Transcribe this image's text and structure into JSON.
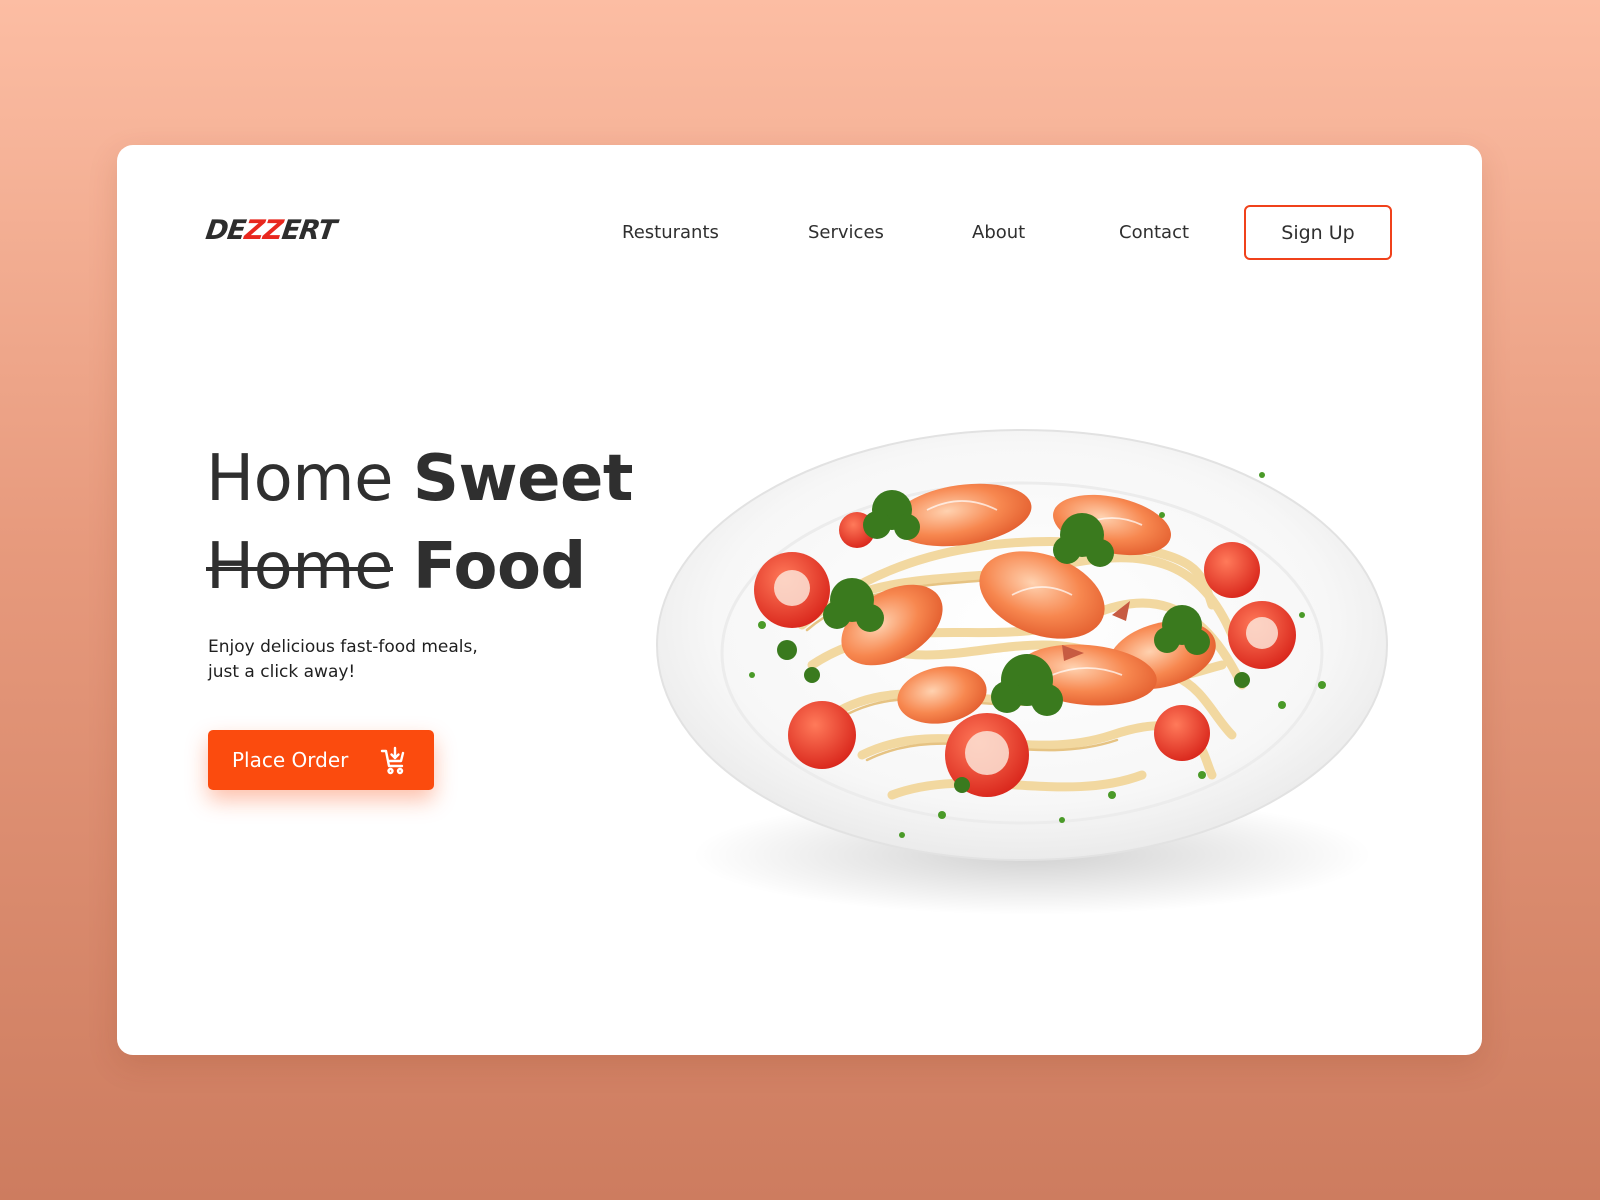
{
  "brand": {
    "logo_part1": "DE",
    "logo_part2": "ZZ",
    "logo_part3": "ERT"
  },
  "nav": {
    "items": [
      {
        "label": "Resturants"
      },
      {
        "label": "Services"
      },
      {
        "label": "About"
      },
      {
        "label": "Contact"
      }
    ],
    "signup_label": "Sign Up"
  },
  "hero": {
    "line1_light": "Home",
    "line1_bold": "Sweet",
    "line2_strike": "Home",
    "line2_bold": "Food",
    "tagline_line1": "Enjoy delicious fast-food meals,",
    "tagline_line2": "just a click away!",
    "cta_label": "Place Order",
    "cta_icon": "cart-download-icon",
    "image": "shrimp-pasta-plate"
  },
  "colors": {
    "accent": "#fb4b0e",
    "outline": "#f0411b",
    "text": "#2f2f2f",
    "background_top": "#fcbda3",
    "background_bottom": "#cd7c5f"
  }
}
